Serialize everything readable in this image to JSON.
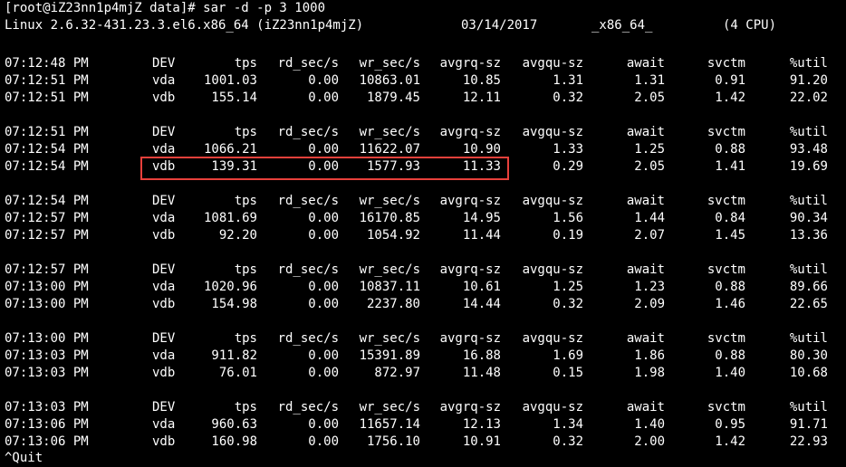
{
  "terminal": {
    "command_line": "[root@iZ23nn1p4mjZ data]# sar -d -p 3 1000",
    "sys_info": {
      "kernel": "Linux 2.6.32-431.23.3.el6.x86_64 (iZ23nn1p4mjZ)",
      "date": "03/14/2017",
      "arch": "_x86_64_",
      "cpus": "(4 CPU)"
    },
    "columns": [
      "DEV",
      "tps",
      "rd_sec/s",
      "wr_sec/s",
      "avgrq-sz",
      "avgqu-sz",
      "await",
      "svctm",
      "%util"
    ],
    "blocks": [
      {
        "header_time": "07:12:48 PM",
        "rows": [
          {
            "time": "07:12:51 PM",
            "dev": "vda",
            "tps": "1001.03",
            "rd": "0.00",
            "wr": "10863.01",
            "avgrq": "10.85",
            "avgqu": "1.31",
            "await": "1.31",
            "svctm": "0.91",
            "util": "91.20"
          },
          {
            "time": "07:12:51 PM",
            "dev": "vdb",
            "tps": "155.14",
            "rd": "0.00",
            "wr": "1879.45",
            "avgrq": "12.11",
            "avgqu": "0.32",
            "await": "2.05",
            "svctm": "1.42",
            "util": "22.02"
          }
        ]
      },
      {
        "header_time": "07:12:51 PM",
        "rows": [
          {
            "time": "07:12:54 PM",
            "dev": "vda",
            "tps": "1066.21",
            "rd": "0.00",
            "wr": "11622.07",
            "avgrq": "10.90",
            "avgqu": "1.33",
            "await": "1.25",
            "svctm": "0.88",
            "util": "93.48"
          },
          {
            "time": "07:12:54 PM",
            "dev": "vdb",
            "tps": "139.31",
            "rd": "0.00",
            "wr": "1577.93",
            "avgrq": "11.33",
            "avgqu": "0.29",
            "await": "2.05",
            "svctm": "1.41",
            "util": "19.69"
          }
        ]
      },
      {
        "header_time": "07:12:54 PM",
        "rows": [
          {
            "time": "07:12:57 PM",
            "dev": "vda",
            "tps": "1081.69",
            "rd": "0.00",
            "wr": "16170.85",
            "avgrq": "14.95",
            "avgqu": "1.56",
            "await": "1.44",
            "svctm": "0.84",
            "util": "90.34"
          },
          {
            "time": "07:12:57 PM",
            "dev": "vdb",
            "tps": "92.20",
            "rd": "0.00",
            "wr": "1054.92",
            "avgrq": "11.44",
            "avgqu": "0.19",
            "await": "2.07",
            "svctm": "1.45",
            "util": "13.36"
          }
        ]
      },
      {
        "header_time": "07:12:57 PM",
        "rows": [
          {
            "time": "07:13:00 PM",
            "dev": "vda",
            "tps": "1020.96",
            "rd": "0.00",
            "wr": "10837.11",
            "avgrq": "10.61",
            "avgqu": "1.25",
            "await": "1.23",
            "svctm": "0.88",
            "util": "89.66"
          },
          {
            "time": "07:13:00 PM",
            "dev": "vdb",
            "tps": "154.98",
            "rd": "0.00",
            "wr": "2237.80",
            "avgrq": "14.44",
            "avgqu": "0.32",
            "await": "2.09",
            "svctm": "1.46",
            "util": "22.65"
          }
        ]
      },
      {
        "header_time": "07:13:00 PM",
        "rows": [
          {
            "time": "07:13:03 PM",
            "dev": "vda",
            "tps": "911.82",
            "rd": "0.00",
            "wr": "15391.89",
            "avgrq": "16.88",
            "avgqu": "1.69",
            "await": "1.86",
            "svctm": "0.88",
            "util": "80.30"
          },
          {
            "time": "07:13:03 PM",
            "dev": "vdb",
            "tps": "76.01",
            "rd": "0.00",
            "wr": "872.97",
            "avgrq": "11.48",
            "avgqu": "0.15",
            "await": "1.98",
            "svctm": "1.40",
            "util": "10.68"
          }
        ]
      },
      {
        "header_time": "07:13:03 PM",
        "rows": [
          {
            "time": "07:13:06 PM",
            "dev": "vda",
            "tps": "960.63",
            "rd": "0.00",
            "wr": "11657.14",
            "avgrq": "12.13",
            "avgqu": "1.34",
            "await": "1.40",
            "svctm": "0.95",
            "util": "91.71"
          },
          {
            "time": "07:13:06 PM",
            "dev": "vdb",
            "tps": "160.98",
            "rd": "0.00",
            "wr": "1756.10",
            "avgrq": "10.91",
            "avgqu": "0.32",
            "await": "2.00",
            "svctm": "1.42",
            "util": "22.93"
          }
        ]
      }
    ],
    "trailing_line": "^Quit",
    "highlight": {
      "color": "#e8403b",
      "block_index": 1,
      "row_index": 1
    }
  }
}
